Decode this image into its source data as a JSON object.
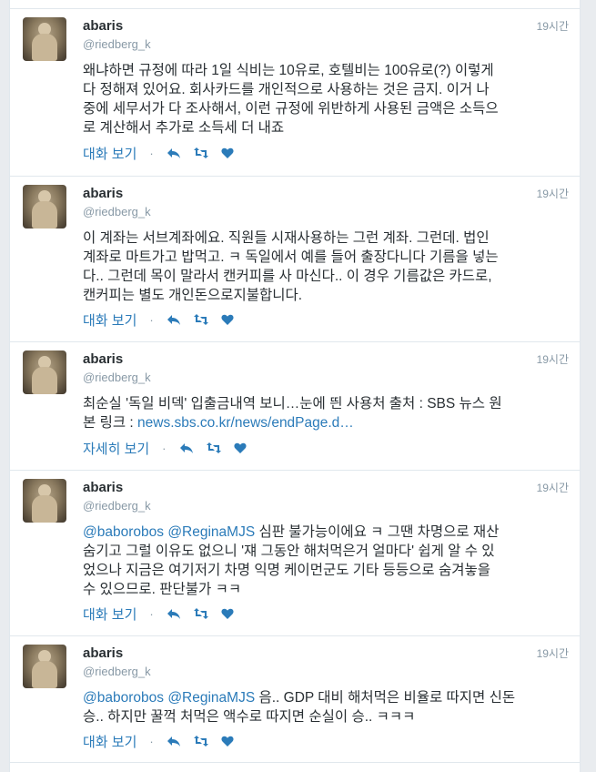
{
  "tweets": [
    {
      "name": "abaris",
      "handle": "@riedberg_k",
      "time": "19시간",
      "text": "왜냐하면 규정에 따라 1일 식비는 10유로, 호텔비는 100유로(?) 이렇게\n다 정해져 있어요. 회사카드를 개인적으로 사용하는 것은 금지. 이거 나\n중에 세무서가 다 조사해서, 이런 규정에 위반하게 사용된 금액은 소득으\n로 계산해서 추가로 소득세 더 내죠",
      "expand_label": "대화 보기"
    },
    {
      "name": "abaris",
      "handle": "@riedberg_k",
      "time": "19시간",
      "text": "이 계좌는 서브계좌에요. 직원들 시재사용하는 그런 계좌. 그런데. 법인\n계좌로 마트가고 밥먹고. ㅋ 독일에서 예를 들어 출장다니다 기름을 넣는\n다.. 그런데 목이 말라서 캔커피를 사 마신다.. 이 경우 기름값은 카드로,\n캔커피는 별도 개인돈으로지불합니다.",
      "expand_label": "대화 보기"
    },
    {
      "name": "abaris",
      "handle": "@riedberg_k",
      "time": "19시간",
      "text_before": "최순실 '독일 비덱' 입출금내역 보니…눈에 띈 사용처 출처 : SBS 뉴스 원\n본 링크 : ",
      "link": "news.sbs.co.kr/news/endPage.d…",
      "expand_label": "자세히 보기"
    },
    {
      "name": "abaris",
      "handle": "@riedberg_k",
      "time": "19시간",
      "mention1": "@baborobos",
      "mention2": "@ReginaMJS",
      "text_after": " 심판 불가능이에요 ㅋ 그땐 차명으로 재산\n숨기고 그럴 이유도 없으니 '쟤 그동안 해처먹은거 얼마다' 쉽게 알 수 있\n었으나 지금은 여기저기 차명 익명 케이먼군도 기타 등등으로 숨겨놓을\n수 있으므로. 판단불가 ㅋㅋ",
      "expand_label": "대화 보기"
    },
    {
      "name": "abaris",
      "handle": "@riedberg_k",
      "time": "19시간",
      "mention1": "@baborobos",
      "mention2": "@ReginaMJS",
      "text_after": " 음.. GDP 대비 해처먹은 비율로 따지면 신돈\n승.. 하지만 꿀꺽 처먹은 액수로 따지면 순실이 승.. ㅋㅋㅋ",
      "expand_label": "대화 보기"
    }
  ],
  "icons": [
    "reply-icon",
    "retweet-icon",
    "favorite-icon"
  ],
  "colors": {
    "link": "#2b7bb9",
    "muted": "#8899a6",
    "text": "#292f33",
    "border": "#e1e8ed"
  }
}
